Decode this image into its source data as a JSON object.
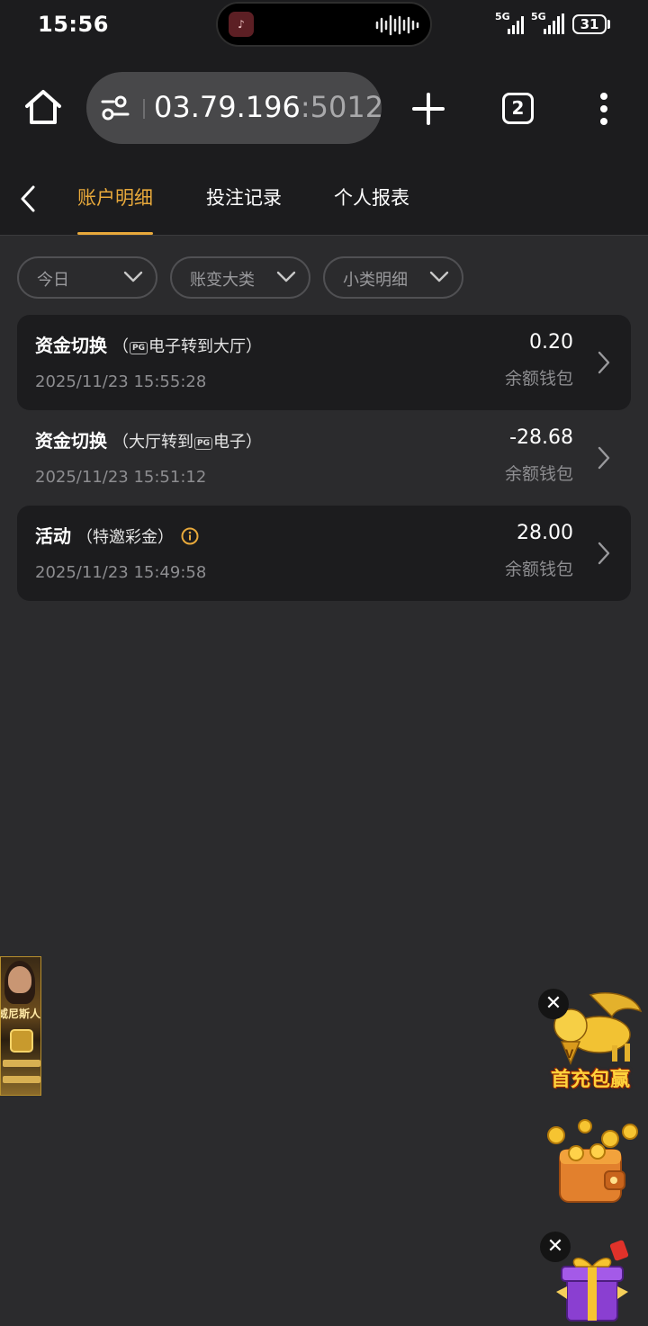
{
  "status_bar": {
    "time": "15:56",
    "signal_1": "5G",
    "signal_2": "5G",
    "battery": "31"
  },
  "browser": {
    "url_main": "03.79.196",
    "url_port": ":5012",
    "tab_count": "2"
  },
  "tabs": [
    {
      "label": "账户明细",
      "active": true
    },
    {
      "label": "投注记录",
      "active": false
    },
    {
      "label": "个人报表",
      "active": false
    }
  ],
  "filters": [
    {
      "label": "今日"
    },
    {
      "label": "账变大类"
    },
    {
      "label": "小类明细"
    }
  ],
  "records": [
    {
      "title": "资金切换",
      "sub_open": "（",
      "sub_badge": "PG",
      "sub_text": "电子转到大厅）",
      "time": "2025/11/23 15:55:28",
      "amount": "0.20",
      "wallet": "余额钱包"
    },
    {
      "title": "资金切换",
      "sub_open": "（大厅转到",
      "sub_badge": "PG",
      "sub_text": "电子）",
      "time": "2025/11/23 15:51:12",
      "amount": "-28.68",
      "wallet": "余额钱包"
    },
    {
      "title": "活动",
      "sub_open": "（特邀彩金）",
      "time": "2025/11/23 15:49:58",
      "amount": "28.00",
      "wallet": "余额钱包"
    }
  ],
  "promos": {
    "side_ad_label": "威尼斯人",
    "lion_label": "首充包赢",
    "close_symbol": "✕"
  },
  "colors": {
    "accent": "#e8a93b",
    "background": "#2b2b2d",
    "card": "#1c1c1e"
  }
}
